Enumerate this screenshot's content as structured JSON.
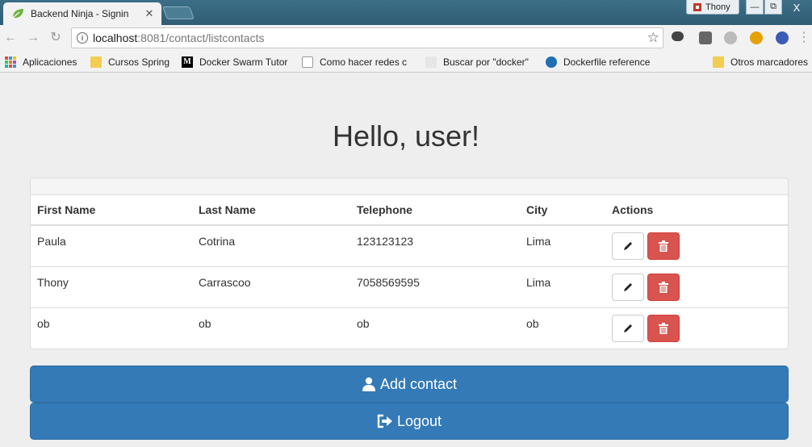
{
  "browser": {
    "tab_title": "Backend Ninja - Signin",
    "tab_close": "✕",
    "profile_name": "Thony",
    "window_min": "—",
    "window_restore": "⧉",
    "window_close": "X",
    "url_host": "localhost",
    "url_rest": ":8081/contact/listcontacts",
    "bookmarks": [
      {
        "label": "Aplicaciones",
        "icon": "apps-icon"
      },
      {
        "label": "Cursos Spring",
        "icon": "folder-icon"
      },
      {
        "label": "Docker Swarm Tutor",
        "icon": "medium-icon"
      },
      {
        "label": "Como hacer redes c",
        "icon": "page-icon"
      },
      {
        "label": "Buscar por \"docker\"",
        "icon": "blank-page-icon"
      },
      {
        "label": "Dockerfile reference",
        "icon": "docker-icon"
      },
      {
        "label": "Otros marcadores",
        "icon": "folder-icon"
      }
    ]
  },
  "page": {
    "heading": "Hello, user!"
  },
  "table": {
    "headers": [
      "First Name",
      "Last Name",
      "Telephone",
      "City",
      "Actions"
    ],
    "rows": [
      {
        "first_name": "Paula",
        "last_name": "Cotrina",
        "telephone": "123123123",
        "city": "Lima"
      },
      {
        "first_name": "Thony",
        "last_name": "Carrascoo",
        "telephone": "7058569595",
        "city": "Lima"
      },
      {
        "first_name": "ob",
        "last_name": "ob",
        "telephone": "ob",
        "city": "ob"
      }
    ]
  },
  "buttons": {
    "add_contact": "Add contact",
    "logout": "Logout"
  },
  "colors": {
    "primary": "#337ab7",
    "danger": "#d9534f",
    "titlebar": "#2f5d74"
  }
}
